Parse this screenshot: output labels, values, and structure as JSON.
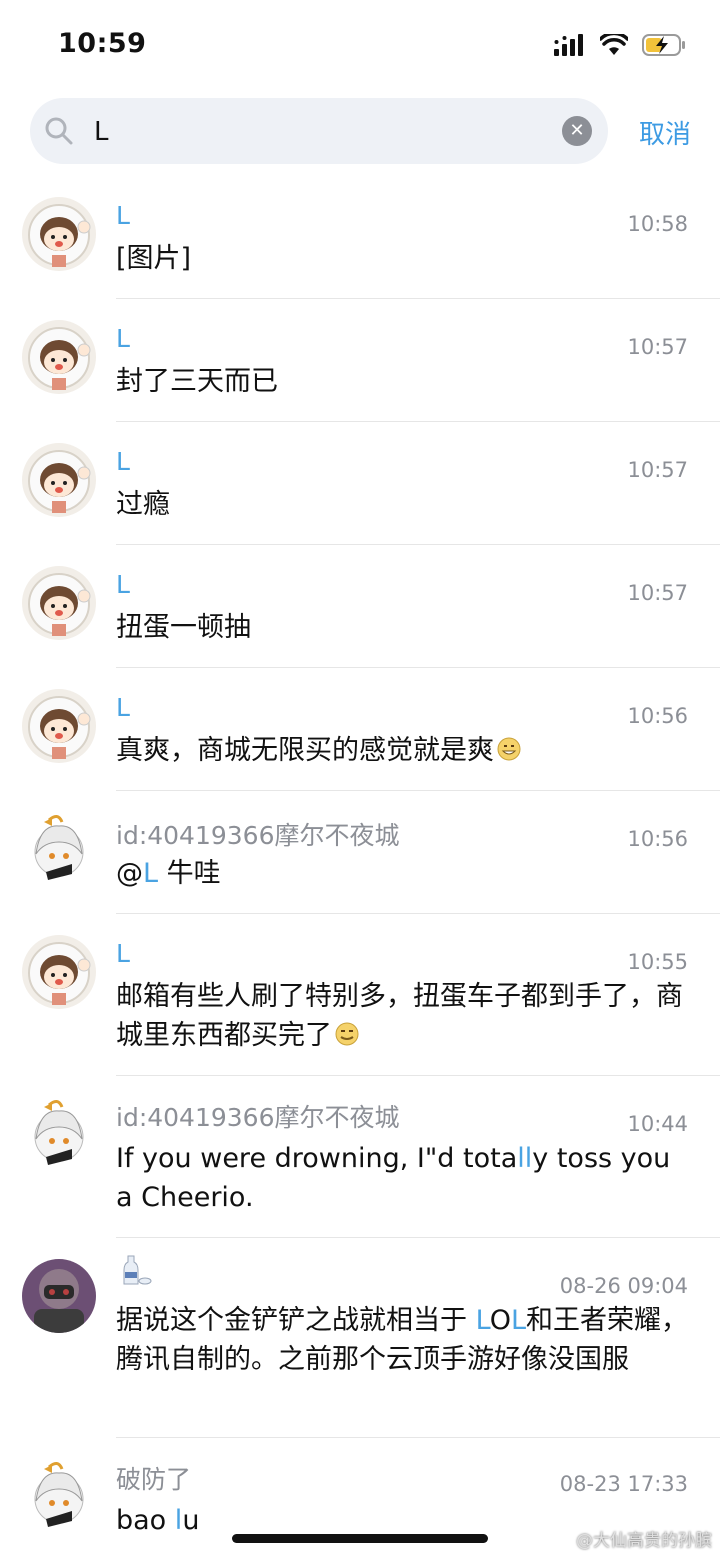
{
  "status_bar": {
    "time": "10:59"
  },
  "search": {
    "value": "L",
    "cancel_label": "取消"
  },
  "results": [
    {
      "name": "L",
      "time": "10:58",
      "message": "[图片]"
    },
    {
      "name": "L",
      "time": "10:57",
      "message": "封了三天而已"
    },
    {
      "name": "L",
      "time": "10:57",
      "message": "过瘾"
    },
    {
      "name": "L",
      "time": "10:57",
      "message": "扭蛋一顿抽"
    },
    {
      "name": "L",
      "time": "10:56",
      "message": "真爽，商城无限买的感觉就是爽"
    },
    {
      "name": "id:40419366摩尔不夜城",
      "time": "10:56",
      "message_prefix": "@",
      "message_mention": "L",
      "message_suffix": " 牛哇"
    },
    {
      "name": "L",
      "time": "10:55",
      "message": "邮箱有些人刷了特别多，扭蛋车子都到手了，商城里东西都买完了"
    },
    {
      "name": "id:40419366摩尔不夜城",
      "time": "10:44",
      "message_a": "If you were drowning, I\"d tota",
      "message_hl": "ll",
      "message_b": "y toss you a Cheerio."
    },
    {
      "name": "",
      "time": "08-26 09:04",
      "message_a": "据说这个金铲铲之战就相当于 ",
      "message_hl1": "L",
      "message_mid": "O",
      "message_hl2": "L",
      "message_b": "和王者荣耀，腾讯自制的。之前那个云顶手游好像没国服"
    },
    {
      "name": "破防了",
      "time": "08-23 17:33",
      "message_a": "bao ",
      "message_hl": "l",
      "message_b": "u"
    }
  ],
  "watermark": "@大仙高贵的孙膑"
}
